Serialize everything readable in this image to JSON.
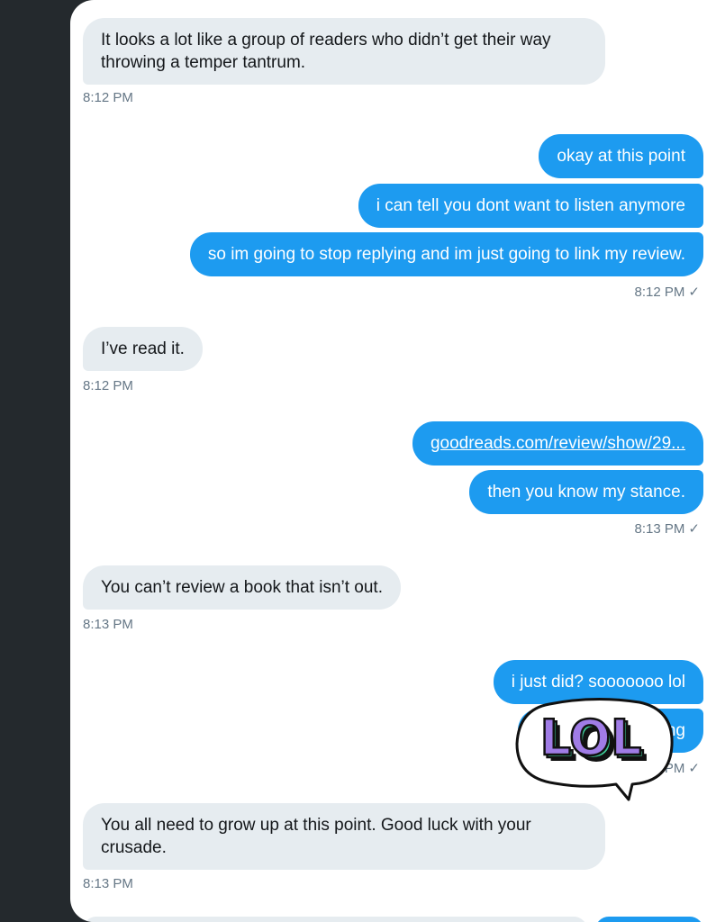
{
  "messages": {
    "m1": {
      "text": "It looks a lot like a group of readers who didn’t get their way throwing a temper tantrum.",
      "time": "8:12 PM"
    },
    "m2a": {
      "text": "okay at this point"
    },
    "m2b": {
      "text": "i can tell you dont want to listen anymore"
    },
    "m2c": {
      "text": "so im going to stop replying and im just going to link my review.",
      "time": "8:12 PM"
    },
    "m3": {
      "text": "I’ve read it.",
      "time": "8:12 PM"
    },
    "m4a": {
      "text": "goodreads.com/review/show/29..."
    },
    "m4b": {
      "text": "then you know my stance.",
      "time": "8:13 PM"
    },
    "m5": {
      "text": "You can’t review a book that isn’t out.",
      "time": "8:13 PM"
    },
    "m6a": {
      "text": "i just did? sooooooo lol"
    },
    "m6b": {
      "text": "ing",
      "time": "PM"
    },
    "m7": {
      "text": "You all need to grow up at this point. Good luck with your crusade.",
      "time": "8:13 PM"
    }
  },
  "sticker": {
    "text": "LOL",
    "fill": "#a07ce6",
    "shadow": "#3ecf9a"
  },
  "check_glyph": "✓",
  "colors": {
    "sidebar": "#24292d",
    "outgoing": "#1d9bf0",
    "incoming": "#e6ecf0"
  }
}
